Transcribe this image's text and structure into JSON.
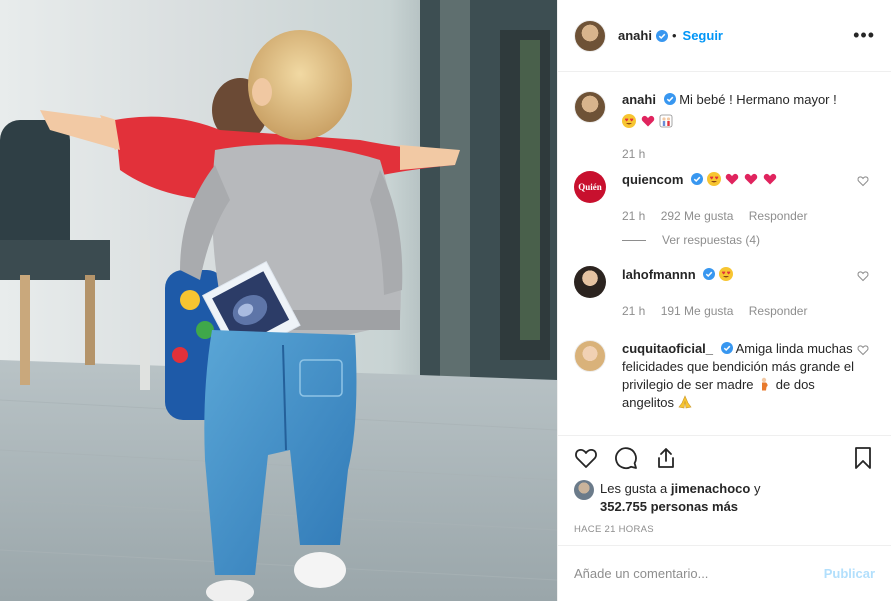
{
  "post": {
    "author": {
      "username": "anahi",
      "follow_label": "Seguir",
      "separator": "•"
    },
    "caption": {
      "username": "anahi",
      "text": "Mi bebé ! Hermano mayor !",
      "time": "21 h"
    },
    "comments": [
      {
        "username": "quiencom",
        "avatar_text": "Quién",
        "time": "21 h",
        "likes": "292 Me gusta",
        "reply_label": "Responder",
        "view_replies": "Ver respuestas (4)"
      },
      {
        "username": "lahofmannn",
        "time": "21 h",
        "likes": "191 Me gusta",
        "reply_label": "Responder"
      },
      {
        "username": "cuquitaoficial_",
        "text_a": "Amiga linda muchas felicidades que bendición más grande el privilegio de ser madre",
        "text_b": "de dos angelitos"
      }
    ],
    "likes_line": {
      "prefix": "Les gusta a",
      "user": "jimenachoco",
      "conj": "y",
      "count": "352.755 personas más"
    },
    "time_ago": "HACE 21 HORAS",
    "add_comment": {
      "placeholder": "Añade un comentario...",
      "publish_label": "Publicar"
    },
    "icons": [
      "heart-icon",
      "comment-icon",
      "share-icon",
      "bookmark-icon",
      "more-options-icon",
      "verified-badge-icon"
    ],
    "colors": {
      "link": "#0095f6",
      "publish_disabled": "#b2dffc",
      "muted": "#8e8e8e",
      "verified": "#3897f0"
    }
  }
}
